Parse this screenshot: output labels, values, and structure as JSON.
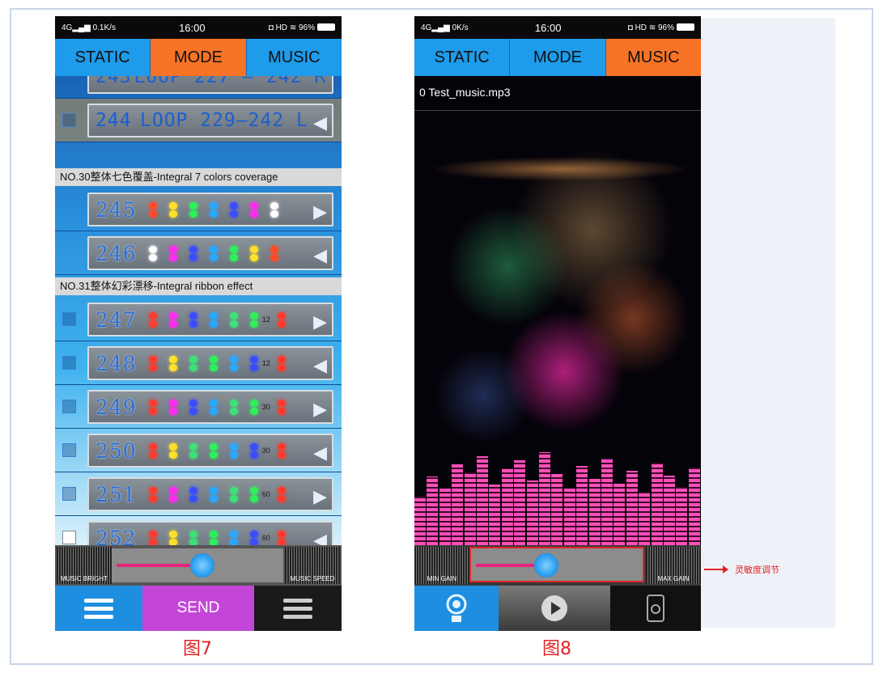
{
  "status": {
    "signal": "4G",
    "speed_left": "0.1K/s",
    "speed_right": "0K/s",
    "time": "16:00",
    "hd": "HD",
    "battery": "96%"
  },
  "tabs": [
    "STATIC",
    "MODE",
    "MUSIC"
  ],
  "mode_list": {
    "partial_row": {
      "number": "243",
      "text": "LOOP 227 — 242 R"
    },
    "row_244": {
      "number": "244",
      "text": "LOOP 229—242 L"
    },
    "header_30": "NO.30整体七色覆盖-Integral 7 colors coverage",
    "header_31": "NO.31整体幻彩漂移-Integral ribbon effect",
    "rows": [
      {
        "number": "245",
        "label": ""
      },
      {
        "number": "246",
        "label": ""
      },
      {
        "number": "247",
        "label": "12"
      },
      {
        "number": "248",
        "label": "12"
      },
      {
        "number": "249",
        "label": "30"
      },
      {
        "number": "250",
        "label": "30"
      },
      {
        "number": "251",
        "label": "60"
      },
      {
        "number": "252",
        "label": "60"
      }
    ]
  },
  "controls": {
    "music_bright": "MUSIC BRIGHT",
    "music_speed": "MUSIC SPEED",
    "send": "SEND",
    "brightness_level": 0.55
  },
  "music": {
    "filename": "0 Test_music.mp3",
    "min_gain": "MIN GAIN",
    "max_gain": "MAX GAIN",
    "sensitivity_level": 0.45
  },
  "annotation": "灵敏度调节",
  "captions": {
    "fig7": "图7",
    "fig8": "图8"
  },
  "colors": {
    "active_tab": "#f77325",
    "tab": "#1e9bea",
    "send": "#c346d9",
    "highlight": "#e02424"
  }
}
